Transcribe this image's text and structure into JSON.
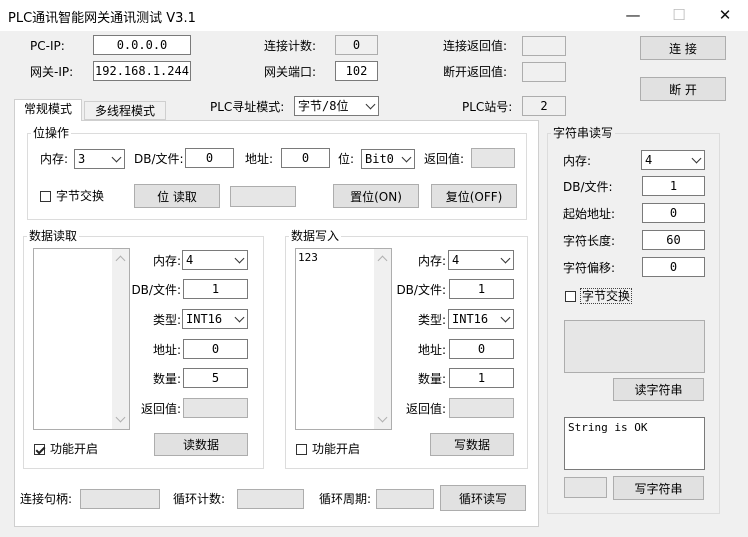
{
  "window": {
    "title": "PLC通讯智能网关通讯测试 V3.1",
    "minimize_glyph": "—",
    "maximize_glyph": "☐",
    "close_glyph": "✕"
  },
  "top": {
    "pc_ip_label": "PC-IP:",
    "pc_ip_value": "0.0.0.0",
    "gateway_ip_label": "网关-IP:",
    "gateway_ip_value": "192.168.1.244",
    "conn_count_label": "连接计数:",
    "conn_count_value": "0",
    "gateway_port_label": "网关端口:",
    "gateway_port_value": "102",
    "connect_return_label": "连接返回值:",
    "connect_return_value": "",
    "disconnect_return_label": "断开返回值:",
    "disconnect_return_value": "",
    "connect_button": "连  接",
    "disconnect_button": "断  开",
    "plc_addr_mode_label": "PLC寻址模式:",
    "plc_addr_mode_value": "字节/8位",
    "plc_station_label": "PLC站号:",
    "plc_station_value": "2"
  },
  "tabs": [
    {
      "label": "常规模式",
      "active": true
    },
    {
      "label": "多线程模式",
      "active": false
    }
  ],
  "bit_op": {
    "title": "位操作",
    "mem_label": "内存:",
    "mem_value": "3",
    "db_label": "DB/文件:",
    "db_value": "0",
    "addr_label": "地址:",
    "addr_value": "0",
    "bit_label": "位:",
    "bit_value": "Bit0",
    "ret_label": "返回值:",
    "ret_value": "",
    "swap_label": "字节交换",
    "read_button": "位 读取",
    "read_result": "",
    "set_button": "置位(ON)",
    "reset_button": "复位(OFF)"
  },
  "data_read": {
    "title": "数据读取",
    "mem_label": "内存:",
    "mem_value": "4",
    "db_label": "DB/文件:",
    "db_value": "1",
    "type_label": "类型:",
    "type_value": "INT16",
    "addr_label": "地址:",
    "addr_value": "0",
    "count_label": "数量:",
    "count_value": "5",
    "ret_label": "返回值:",
    "ret_value": "",
    "enable_label": "功能开启",
    "read_button": "读数据"
  },
  "data_write": {
    "title": "数据写入",
    "list_text": "123",
    "mem_label": "内存:",
    "mem_value": "4",
    "db_label": "DB/文件:",
    "db_value": "1",
    "type_label": "类型:",
    "type_value": "INT16",
    "addr_label": "地址:",
    "addr_value": "0",
    "count_label": "数量:",
    "count_value": "1",
    "ret_label": "返回值:",
    "ret_value": "",
    "enable_label": "功能开启",
    "write_button": "写数据"
  },
  "bottom": {
    "handle_label": "连接句柄:",
    "handle_value": "",
    "loop_count_label": "循环计数:",
    "loop_count_value": "",
    "loop_period_label": "循环周期:",
    "loop_period_value": "",
    "loop_button": "循环读写"
  },
  "string_rw": {
    "title": "字符串读写",
    "mem_label": "内存:",
    "mem_value": "4",
    "db_label": "DB/文件:",
    "db_value": "1",
    "start_label": "起始地址:",
    "start_value": "0",
    "len_label": "字符长度:",
    "len_value": "60",
    "offset_label": "字符偏移:",
    "offset_value": "0",
    "swap_label": "字节交换",
    "read_result": "",
    "read_button": "读字符串",
    "write_text": "String is OK",
    "write_small": "",
    "write_button": "写字符串"
  }
}
